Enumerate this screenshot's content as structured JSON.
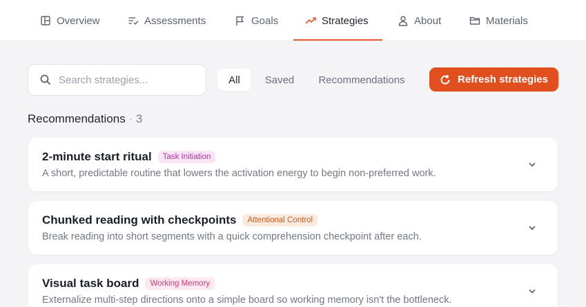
{
  "nav": {
    "tabs": [
      {
        "label": "Overview",
        "icon": "layout-icon"
      },
      {
        "label": "Assessments",
        "icon": "checklist-icon"
      },
      {
        "label": "Goals",
        "icon": "flag-icon"
      },
      {
        "label": "Strategies",
        "icon": "trending-up-icon",
        "active": true
      },
      {
        "label": "About",
        "icon": "user-icon"
      },
      {
        "label": "Materials",
        "icon": "folder-icon"
      }
    ],
    "accent": "#e4582a"
  },
  "toolbar": {
    "search_placeholder": "Search strategies...",
    "filters": [
      "All",
      "Saved",
      "Recommendations"
    ],
    "active_filter": "All",
    "refresh_label": "Refresh strategies"
  },
  "section": {
    "title": "Recommendations",
    "separator": "·",
    "count": "3"
  },
  "cards": [
    {
      "title": "2-minute start ritual",
      "badge": "Task Initiation",
      "badge_bg": "#f8e6f7",
      "badge_color": "#b1359e",
      "description": "A short, predictable routine that lowers the activation energy to begin non-preferred work."
    },
    {
      "title": "Chunked reading with checkpoints",
      "badge": "Attentional Control",
      "badge_bg": "#fdeadf",
      "badge_color": "#d05a1c",
      "description": "Break reading into short segments with a quick comprehension checkpoint after each."
    },
    {
      "title": "Visual task board",
      "badge": "Working Memory",
      "badge_bg": "#fde7f0",
      "badge_color": "#cf3a7c",
      "description": "Externalize multi-step directions onto a simple board so working memory isn't the bottleneck."
    }
  ]
}
